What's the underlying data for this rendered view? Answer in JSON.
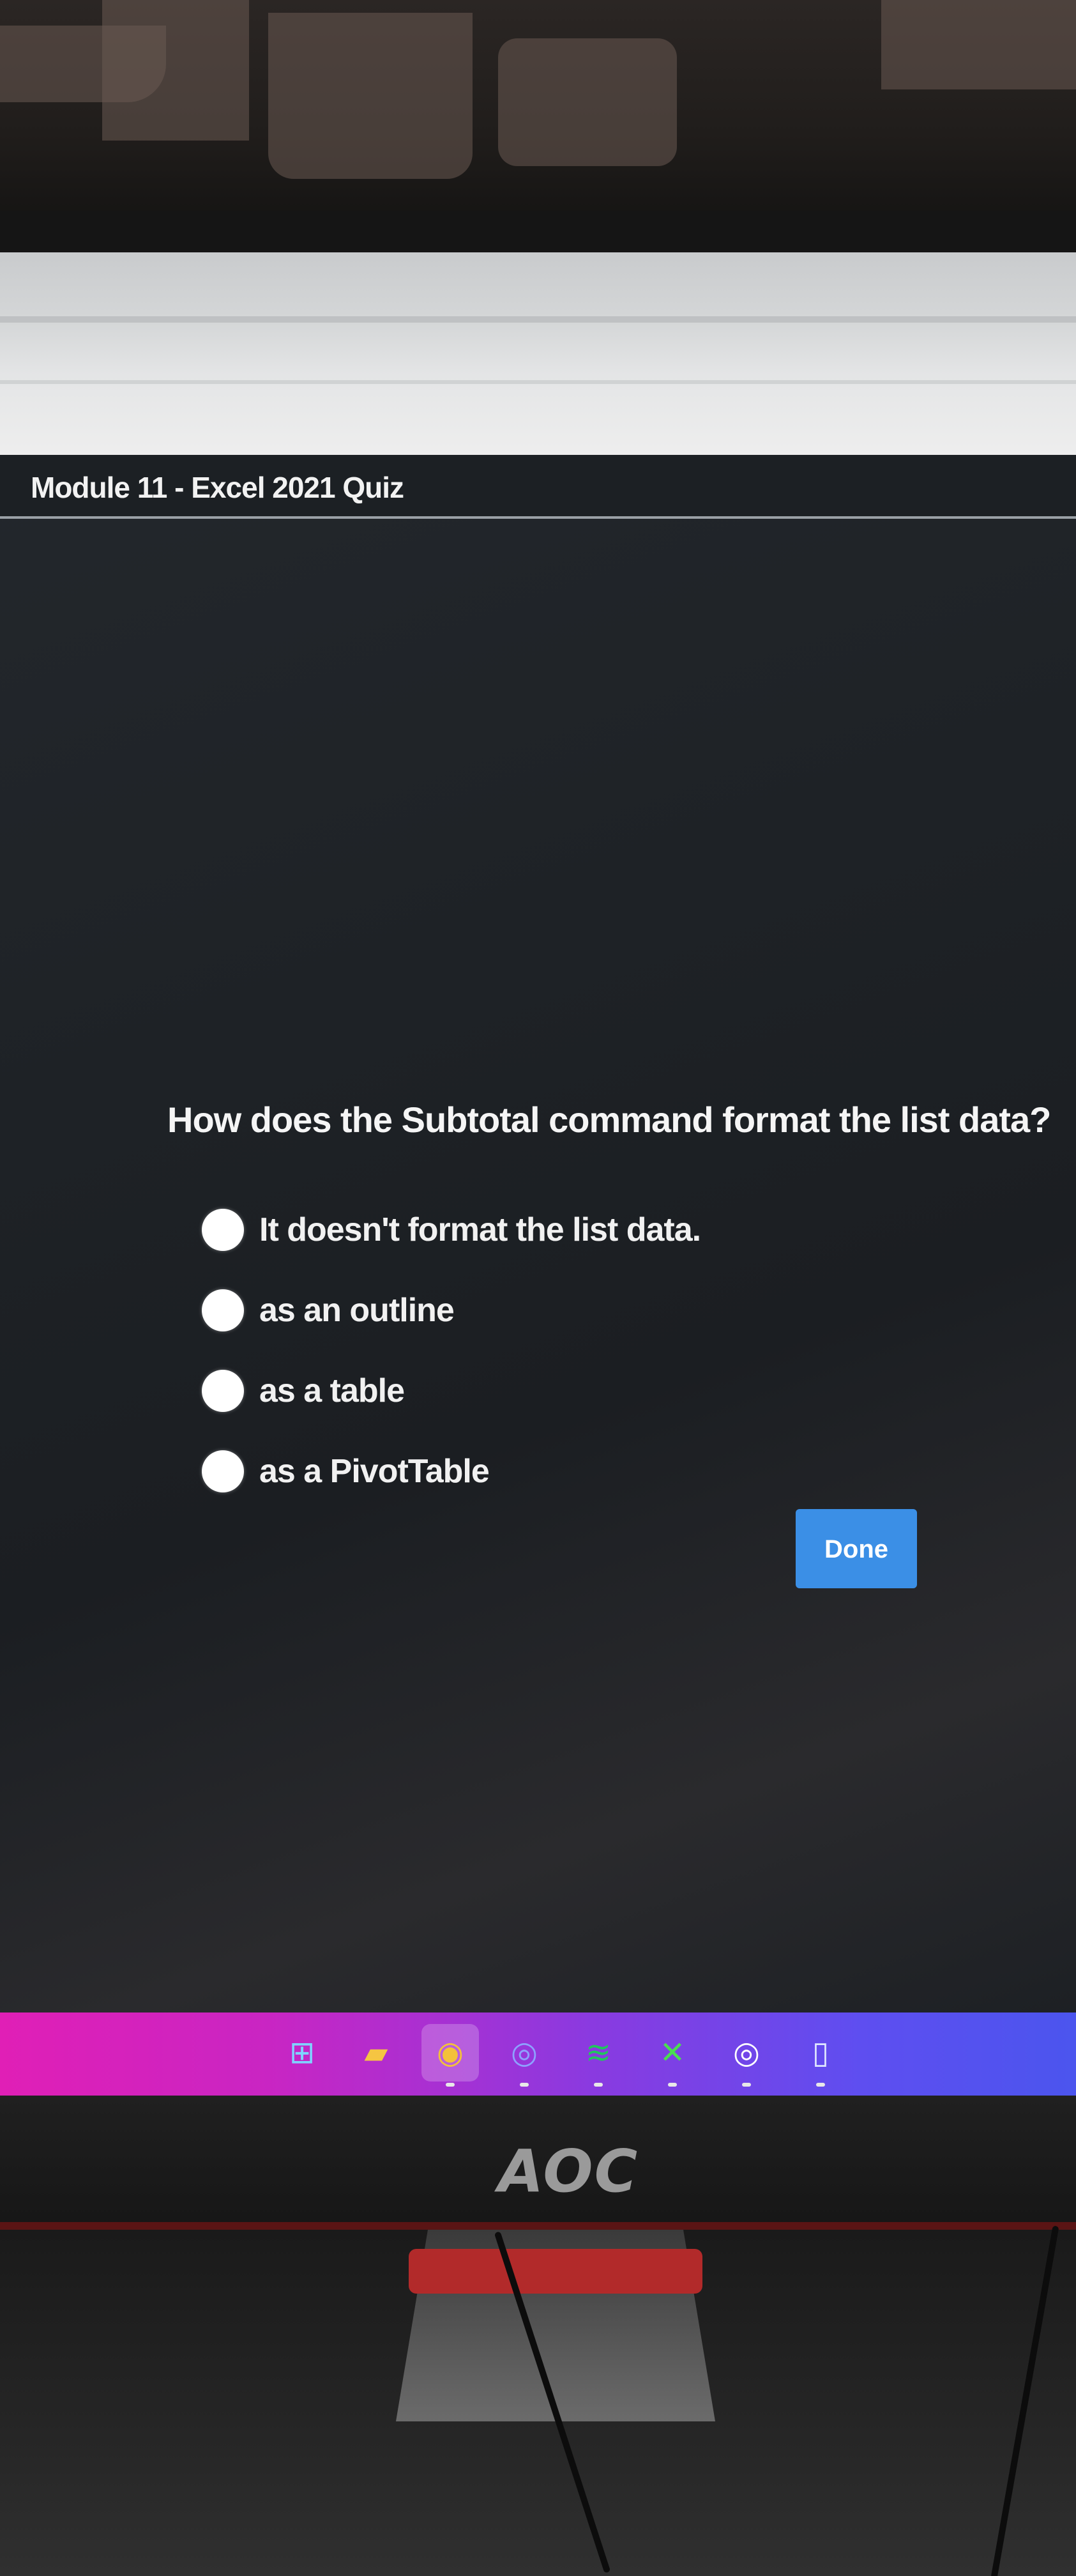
{
  "app": {
    "title": "Module 11 - Excel 2021 Quiz"
  },
  "quiz": {
    "question": "How does the Subtotal command format the list data?",
    "options": [
      {
        "label": "It doesn't format the list data.",
        "selected": false
      },
      {
        "label": "as an outline",
        "selected": false
      },
      {
        "label": "as a table",
        "selected": false
      },
      {
        "label": "as a PivotTable",
        "selected": false
      }
    ],
    "done_label": "Done"
  },
  "taskbar": {
    "icons": [
      {
        "name": "windows-start-icon",
        "glyph": "⊞"
      },
      {
        "name": "file-explorer-icon",
        "glyph": "▰"
      },
      {
        "name": "chrome-icon",
        "glyph": "◉"
      },
      {
        "name": "discord-icon",
        "glyph": "◎"
      },
      {
        "name": "spotify-icon",
        "glyph": "≋"
      },
      {
        "name": "xbox-icon",
        "glyph": "✕"
      },
      {
        "name": "app-icon",
        "glyph": "◎"
      },
      {
        "name": "app-icon-2",
        "glyph": "▯"
      }
    ]
  },
  "monitor": {
    "brand": "AOC"
  },
  "colors": {
    "app_background": "#1e2226",
    "button_blue": "#3b8fe6",
    "radio_fill": "#ffffff",
    "text_light": "#f5f5f5",
    "taskbar_start": "#e01fb6",
    "taskbar_end": "#4b55ee"
  }
}
